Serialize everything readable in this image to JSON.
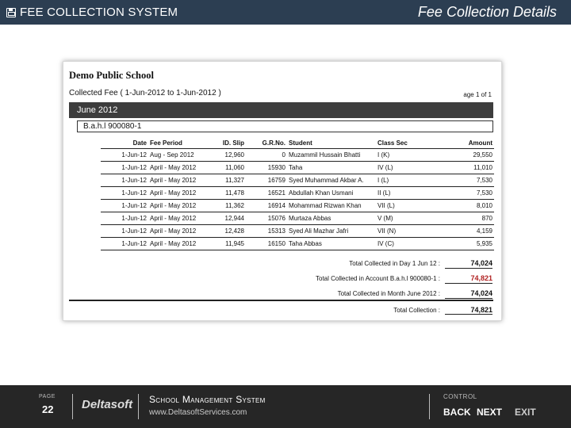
{
  "header": {
    "app_title": "FEE COLLECTION SYSTEM",
    "page_heading": "Fee Collection Details"
  },
  "report": {
    "school_name": "Demo Public School",
    "collected_line": "Collected Fee ( 1-Jun-2012 to 1-Jun-2012 )",
    "page_indicator": "age 1 of 1",
    "month": "June 2012",
    "account": "B.a.h.l 900080-1",
    "columns": [
      "Date",
      "Fee Period",
      "ID. Slip",
      "G.R.No.",
      "Student",
      "Class Sec",
      "Amount"
    ],
    "rows": [
      [
        "1-Jun-12",
        "Aug - Sep 2012",
        "12,960",
        "0",
        "Muzammil Hussain Bhatti",
        "I (K)",
        "29,550"
      ],
      [
        "1-Jun-12",
        "April - May 2012",
        "11,060",
        "15930",
        "Taha",
        "IV (L)",
        "11,010"
      ],
      [
        "1-Jun-12",
        "April - May 2012",
        "11,327",
        "16759",
        "Syed Muhammad Akbar A.",
        "I (L)",
        "7,530"
      ],
      [
        "1-Jun-12",
        "April - May 2012",
        "11,478",
        "16521",
        "Abdullah Khan Usmani",
        "II (L)",
        "7,530"
      ],
      [
        "1-Jun-12",
        "April - May 2012",
        "11,362",
        "16914",
        "Mohammad Rizwan Khan",
        "VII (L)",
        "8,010"
      ],
      [
        "1-Jun-12",
        "April - May 2012",
        "12,944",
        "15076",
        "Murtaza Abbas",
        "V (M)",
        "870"
      ],
      [
        "1-Jun-12",
        "April - May 2012",
        "12,428",
        "15313",
        "Syed Ali Mazhar Jafri",
        "VII (N)",
        "4,159"
      ],
      [
        "1-Jun-12",
        "April - May 2012",
        "11,945",
        "16150",
        "Taha Abbas",
        "IV (C)",
        "5,935"
      ]
    ],
    "totals": [
      {
        "label": "Total Collected in Day 1 Jun 12 :",
        "value": "74,024"
      },
      {
        "label": "Total Collected in Account B.a.h.l 900080-1 :",
        "value": "74,821"
      },
      {
        "label": "Total Collected in Month June 2012 :",
        "value": "74,024"
      }
    ],
    "grand_total_label": "Total Collection :",
    "grand_total_value": "74,821"
  },
  "footer": {
    "page_caption": "PAGE",
    "page_number": "22",
    "brand": "Deltasoft",
    "system_name": "School Management System",
    "website": "www.DeltasoftServices.com",
    "control_caption": "CONTROL",
    "back_label": "BACK",
    "next_label": "NEXT",
    "exit_label": "EXIT"
  },
  "colors": {
    "header_bg": "#2c3e52",
    "footer_bg": "#262626",
    "month_bar_bg": "#3d3d3d",
    "highlight_total": "#b02020"
  }
}
